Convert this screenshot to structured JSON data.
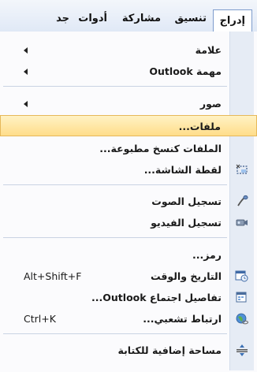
{
  "menubar": {
    "items": [
      {
        "label": "إدراج",
        "active": true
      },
      {
        "label": "تنسيق"
      },
      {
        "label": "مشاركة"
      },
      {
        "label": "أدوات"
      },
      {
        "label": "جد"
      }
    ]
  },
  "menu": {
    "items": [
      {
        "label": "علامة",
        "submenu": true,
        "icon": null
      },
      {
        "label": "مهمة Outlook",
        "submenu": true,
        "icon": null
      },
      {
        "label": "صور",
        "submenu": true,
        "icon": null
      },
      {
        "label": "ملفات...",
        "highlighted": true,
        "icon": null
      },
      {
        "label": "الملفات كنسخ مطبوعة...",
        "icon": null
      },
      {
        "label": "لقطة الشاشة...",
        "icon": "screen-clipping-icon"
      },
      {
        "label": "تسجيل الصوت",
        "icon": "microphone-icon"
      },
      {
        "label": "تسجيل الفيديو",
        "icon": "video-camera-icon"
      },
      {
        "label": "رمز...",
        "icon": null
      },
      {
        "label": "التاريخ والوقت",
        "shortcut": "Alt+Shift+F",
        "icon": "calendar-clock-icon"
      },
      {
        "label": "تفاصيل اجتماع Outlook...",
        "icon": "meeting-details-icon"
      },
      {
        "label": "ارتباط تشعبي...",
        "shortcut": "Ctrl+K",
        "icon": "hyperlink-globe-icon"
      },
      {
        "label": "مساحة إضافية للكتابة",
        "icon": "extra-space-icon"
      }
    ]
  }
}
